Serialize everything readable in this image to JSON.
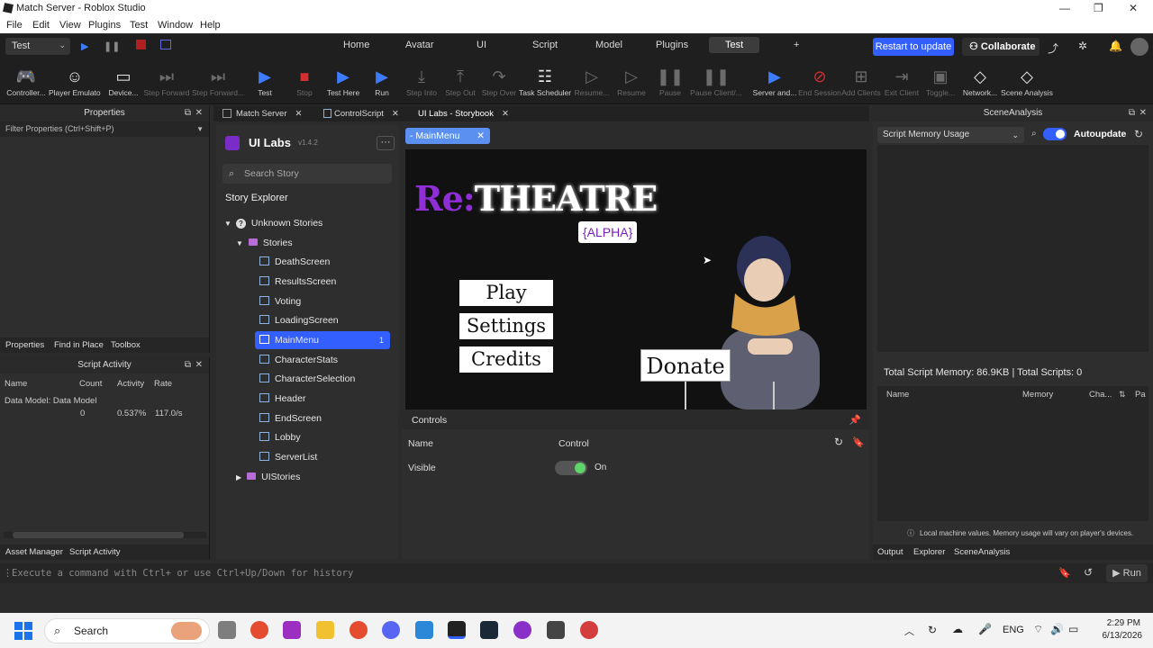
{
  "window": {
    "title": "Match Server - Roblox Studio"
  },
  "menu": [
    "File",
    "Edit",
    "View",
    "Plugins",
    "Test",
    "Window",
    "Help"
  ],
  "mode_select": "Test",
  "top_tabs": [
    "Home",
    "Avatar",
    "UI",
    "Script",
    "Model",
    "Plugins",
    "Test",
    "+"
  ],
  "update_button": "Restart to update",
  "collaborate_button": "Collaborate",
  "ribbon": [
    {
      "label": "Controller...",
      "icon": "gamepad-icon"
    },
    {
      "label": "Player Emulator",
      "icon": "person-icon"
    },
    {
      "label": "Device...",
      "icon": "device-icon"
    },
    {
      "label": "Step Forward",
      "icon": "step-forward-icon",
      "dim": true
    },
    {
      "label": "Step Forward...",
      "icon": "step-forward-icon",
      "dim": true
    },
    {
      "label": "Test",
      "icon": "play-icon"
    },
    {
      "label": "Stop",
      "icon": "stop-icon",
      "dim": true
    },
    {
      "label": "Test Here",
      "icon": "play-here-icon"
    },
    {
      "label": "Run",
      "icon": "run-icon"
    },
    {
      "label": "Step Into",
      "icon": "step-into-icon",
      "dim": true
    },
    {
      "label": "Step Out",
      "icon": "step-out-icon",
      "dim": true
    },
    {
      "label": "Step Over",
      "icon": "step-over-icon",
      "dim": true
    },
    {
      "label": "Task Scheduler",
      "icon": "task-scheduler-icon"
    },
    {
      "label": "Resume...",
      "icon": "resume-icon",
      "dim": true
    },
    {
      "label": "Resume",
      "icon": "resume-icon",
      "dim": true
    },
    {
      "label": "Pause",
      "icon": "pause-icon",
      "dim": true
    },
    {
      "label": "Pause Client/...",
      "icon": "pause-icon",
      "dim": true
    },
    {
      "label": "Server and...",
      "icon": "server-icon"
    },
    {
      "label": "End Session",
      "icon": "end-session-icon",
      "dim": true
    },
    {
      "label": "Add Clients",
      "icon": "add-clients-icon",
      "dim": true
    },
    {
      "label": "Exit Client",
      "icon": "exit-client-icon",
      "dim": true
    },
    {
      "label": "Toggle...",
      "icon": "toggle-icon",
      "dim": true
    },
    {
      "label": "Network...",
      "icon": "network-icon"
    },
    {
      "label": "Scene Analysis",
      "icon": "scene-analysis-icon"
    }
  ],
  "properties": {
    "title": "Properties",
    "filter": "Filter Properties (Ctrl+Shift+P)",
    "subtabs": [
      "Properties",
      "Find in Place",
      "Toolbox"
    ]
  },
  "script_activity": {
    "title": "Script Activity",
    "columns": [
      "Name",
      "Count",
      "Activity",
      "Rate"
    ],
    "row_name": "Data Model: Data Model",
    "row_count": "0",
    "row_activity": "0.537%",
    "row_rate": "117.0/s",
    "subtabs": [
      "Asset Manager",
      "Script Activity"
    ]
  },
  "doc_tabs": [
    "Match Server",
    "ControlScript",
    "UI Labs - Storybook"
  ],
  "storybook": {
    "title": "UI Labs",
    "version": "v1.4.2",
    "search_placeholder": "Search Story",
    "explorer_title": "Story Explorer",
    "unknown_stories": "Unknown Stories",
    "stories_folder": "Stories",
    "stories": [
      "DeathScreen",
      "ResultsScreen",
      "Voting",
      "LoadingScreen",
      "MainMenu",
      "CharacterStats",
      "CharacterSelection",
      "Header",
      "EndScreen",
      "Lobby",
      "ServerList"
    ],
    "selected_badge": "1",
    "ui_stories": "UIStories"
  },
  "preview": {
    "story_tab": "- MainMenu",
    "title_re": "Re:",
    "title_rest": "THEATRE",
    "alpha": "{ALPHA}",
    "buttons": [
      "Play",
      "Settings",
      "Credits"
    ],
    "donate": "Donate"
  },
  "controls": {
    "title": "Controls",
    "col_name": "Name",
    "col_control": "Control",
    "row_name": "Visible",
    "row_state": "On"
  },
  "scene_analysis": {
    "title": "SceneAnalysis",
    "select": "Script Memory Usage",
    "autoupdate": "Autoupdate",
    "summary": "Total Script Memory: 86.9KB | Total Scripts: 0",
    "columns": [
      "Name",
      "Memory",
      "Cha...",
      "Pa"
    ],
    "note": "Local machine values. Memory usage will vary on player's devices.",
    "subtabs": [
      "Output",
      "Explorer",
      "SceneAnalysis"
    ]
  },
  "command_bar": {
    "placeholder": "Execute a command with Ctrl+ or use Ctrl+Up/Down for history",
    "run": "Run"
  },
  "taskbar": {
    "search": "Search",
    "lang": "ENG",
    "time": "2:29 PM",
    "date": "6/13/2026"
  }
}
